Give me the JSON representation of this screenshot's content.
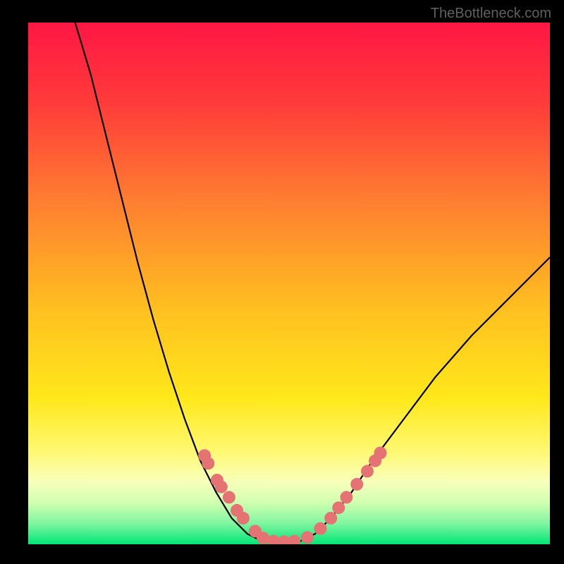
{
  "watermark": "TheBottleneck.com",
  "chart_data": {
    "type": "line",
    "title": "",
    "xlabel": "",
    "ylabel": "",
    "xlim": [
      0,
      100
    ],
    "ylim": [
      0,
      100
    ],
    "curve_left": [
      {
        "x": 9,
        "y": 100
      },
      {
        "x": 12,
        "y": 90
      },
      {
        "x": 15,
        "y": 78
      },
      {
        "x": 18,
        "y": 66
      },
      {
        "x": 21,
        "y": 54
      },
      {
        "x": 24,
        "y": 43
      },
      {
        "x": 27,
        "y": 33
      },
      {
        "x": 30,
        "y": 24
      },
      {
        "x": 33,
        "y": 16
      },
      {
        "x": 36,
        "y": 10
      },
      {
        "x": 39,
        "y": 5
      },
      {
        "x": 42,
        "y": 2
      },
      {
        "x": 45,
        "y": 0.5
      }
    ],
    "curve_right": [
      {
        "x": 52,
        "y": 0.5
      },
      {
        "x": 55,
        "y": 2
      },
      {
        "x": 58,
        "y": 5
      },
      {
        "x": 62,
        "y": 10
      },
      {
        "x": 66,
        "y": 16
      },
      {
        "x": 72,
        "y": 24
      },
      {
        "x": 78,
        "y": 32
      },
      {
        "x": 85,
        "y": 40
      },
      {
        "x": 92,
        "y": 47
      },
      {
        "x": 100,
        "y": 55
      }
    ],
    "flat_bottom": [
      {
        "x": 45,
        "y": 0.5
      },
      {
        "x": 52,
        "y": 0.5
      }
    ],
    "markers": [
      {
        "x": 33.8,
        "y": 17
      },
      {
        "x": 34.5,
        "y": 15.5
      },
      {
        "x": 36.2,
        "y": 12.3
      },
      {
        "x": 37,
        "y": 11
      },
      {
        "x": 38.5,
        "y": 9
      },
      {
        "x": 40,
        "y": 6.5
      },
      {
        "x": 41.2,
        "y": 5
      },
      {
        "x": 43.5,
        "y": 2.5
      },
      {
        "x": 45,
        "y": 1.2
      },
      {
        "x": 47,
        "y": 0.6
      },
      {
        "x": 49,
        "y": 0.5
      },
      {
        "x": 51,
        "y": 0.6
      },
      {
        "x": 53.5,
        "y": 1.3
      },
      {
        "x": 56,
        "y": 3
      },
      {
        "x": 58,
        "y": 5
      },
      {
        "x": 59.5,
        "y": 7
      },
      {
        "x": 61,
        "y": 9
      },
      {
        "x": 63,
        "y": 11.5
      },
      {
        "x": 65,
        "y": 14
      },
      {
        "x": 66.5,
        "y": 16
      },
      {
        "x": 67.5,
        "y": 17.5
      }
    ],
    "gradient_stops": [
      {
        "offset": 0,
        "color": "#ff1744"
      },
      {
        "offset": 0.15,
        "color": "#ff3a3a"
      },
      {
        "offset": 0.35,
        "color": "#ff8030"
      },
      {
        "offset": 0.55,
        "color": "#ffc020"
      },
      {
        "offset": 0.72,
        "color": "#ffe81a"
      },
      {
        "offset": 0.82,
        "color": "#fff870"
      },
      {
        "offset": 0.88,
        "color": "#f8ffba"
      },
      {
        "offset": 0.92,
        "color": "#d0ffb0"
      },
      {
        "offset": 0.96,
        "color": "#80f5a0"
      },
      {
        "offset": 1.0,
        "color": "#00e676"
      }
    ],
    "marker_color": "#e57373",
    "curve_color": "#000000"
  }
}
